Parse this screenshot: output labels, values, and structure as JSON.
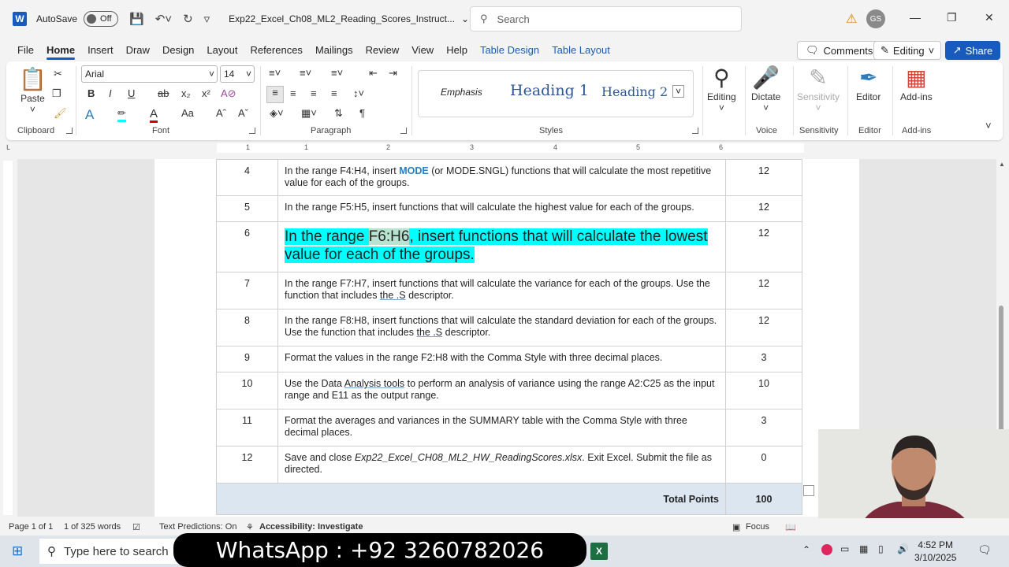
{
  "titlebar": {
    "app_logo": "W",
    "autosave_label": "AutoSave",
    "autosave_state": "Off",
    "doc_title": "Exp22_Excel_Ch08_ML2_Reading_Scores_Instruct...",
    "search_placeholder": "Search",
    "user_initials": "GS"
  },
  "menu": {
    "tabs": [
      "File",
      "Home",
      "Insert",
      "Draw",
      "Design",
      "Layout",
      "References",
      "Mailings",
      "Review",
      "View",
      "Help",
      "Table Design",
      "Table Layout"
    ],
    "comments": "Comments",
    "editing": "Editing",
    "share": "Share"
  },
  "ribbon": {
    "clipboard": {
      "label": "Clipboard",
      "paste": "Paste"
    },
    "font": {
      "label": "Font",
      "font_name": "Arial",
      "font_size": "14",
      "change_case": "Aa"
    },
    "paragraph": {
      "label": "Paragraph"
    },
    "styles": {
      "label": "Styles",
      "items": [
        "Emphasis",
        "Heading 1",
        "Heading 2"
      ]
    },
    "editing": {
      "label": "Editing"
    },
    "voice": {
      "label": "Voice",
      "dictate": "Dictate"
    },
    "sensitivity": {
      "label": "Sensitivity",
      "button": "Sensitivity"
    },
    "editor": {
      "label": "Editor",
      "button": "Editor"
    },
    "addins": {
      "label": "Add-ins",
      "button": "Add-ins"
    }
  },
  "ruler": {
    "numbers": [
      "1",
      "1",
      "2",
      "3",
      "4",
      "5",
      "6"
    ]
  },
  "table": {
    "rows": [
      {
        "num": "4",
        "pre": "In the range F4:H4, insert ",
        "kw": "MODE",
        "post": " (or MODE.SNGL) functions that will calculate the most repetitive value for each of the groups.",
        "points": "12"
      },
      {
        "num": "5",
        "text": "In the range F5:H5, insert functions that will calculate the highest value for each of the groups.",
        "points": "12"
      },
      {
        "num": "6",
        "pre": "In the range ",
        "sel": "F6:H6",
        "post": ", insert functions that will calculate the lowest value for each of the groups.",
        "points": "12"
      },
      {
        "num": "7",
        "pre": "In the range F7:H7, insert functions that will calculate the variance for each of the groups. Use the function that includes ",
        "ul": "the .S",
        "post": " descriptor.",
        "points": "12"
      },
      {
        "num": "8",
        "pre": "In the range F8:H8, insert functions that will calculate the standard deviation for each of the groups. Use the function that includes ",
        "ul": "the .S",
        "post": " descriptor.",
        "points": "12"
      },
      {
        "num": "9",
        "text": "Format the values in the range F2:H8 with the Comma Style with three decimal places.",
        "points": "3"
      },
      {
        "num": "10",
        "pre": "Use the Data ",
        "ul": "Analysis tools",
        "post": " to perform an analysis of variance using the range A2:C25 as the input range and E11 as the output range.",
        "points": "10"
      },
      {
        "num": "11",
        "text": "Format the averages and variances in the SUMMARY table with the Comma Style with three decimal places.",
        "points": "3"
      },
      {
        "num": "12",
        "pre": "Save and close ",
        "it": "Exp22_Excel_CH08_ML2_HW_ReadingScores.xlsx",
        "post": ". Exit Excel. Submit the file as directed.",
        "points": "0"
      }
    ],
    "total_label": "Total Points",
    "total_value": "100"
  },
  "statusbar": {
    "page": "Page 1 of 1",
    "words": "1 of 325 words",
    "predictions": "Text Predictions: On",
    "accessibility": "Accessibility: Investigate",
    "focus": "Focus"
  },
  "taskbar": {
    "search_placeholder": "Type here to search",
    "banner": "WhatsApp : +92 3260782026",
    "time": "4:52 PM",
    "date": "3/10/2025"
  },
  "colors": {
    "accent": "#185abd",
    "highlight": "#00ffff",
    "keyword": "#2b7dbd"
  }
}
